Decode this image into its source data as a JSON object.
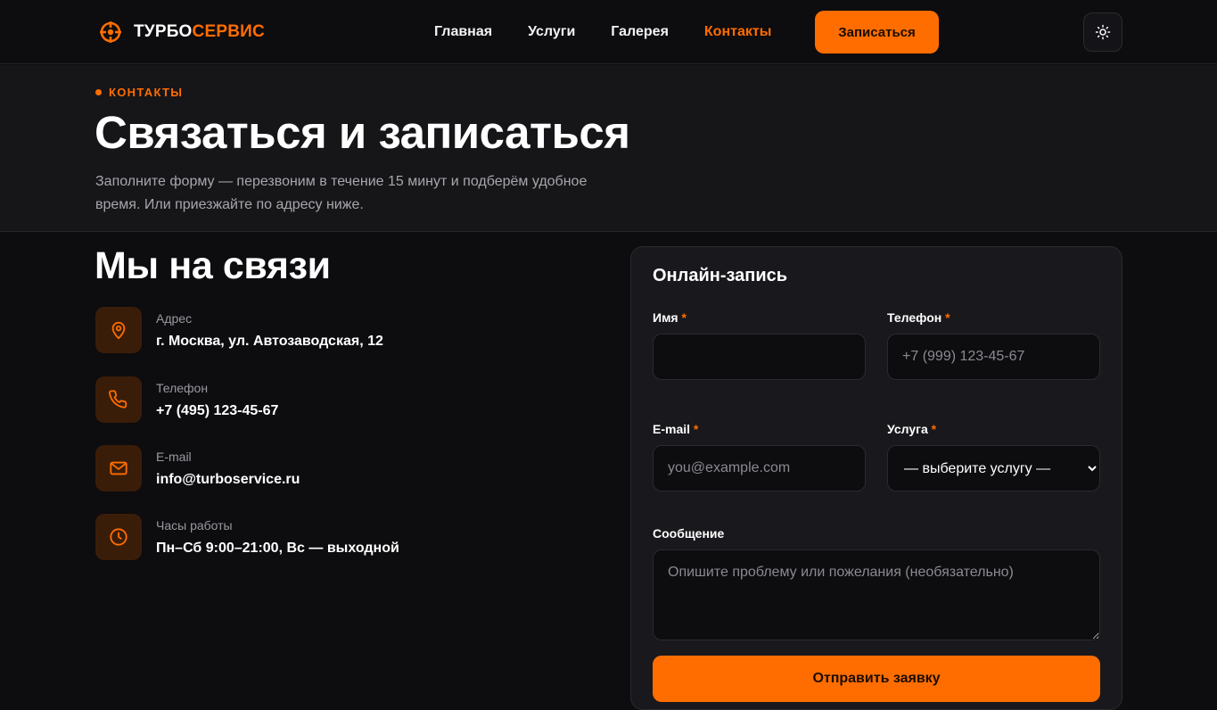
{
  "brand": {
    "name_part1": "ТУРБО",
    "name_part2": "СЕРВИС",
    "accent": "#ff6d00"
  },
  "nav": {
    "items": [
      {
        "label": "Главная",
        "active": false
      },
      {
        "label": "Услуги",
        "active": false
      },
      {
        "label": "Галерея",
        "active": false
      },
      {
        "label": "Контакты",
        "active": true
      }
    ],
    "cta_label": "Записаться",
    "theme_toggle_icon": "sun-icon"
  },
  "hero": {
    "eyebrow": "КОНТАКТЫ",
    "title": "Связаться и записаться",
    "subtitle": "Заполните форму — перезвоним в течение 15 минут и подберём удобное время. Или приезжайте по адресу ниже."
  },
  "contacts": {
    "title": "Мы на связи",
    "items": [
      {
        "icon": "map-pin-icon",
        "label": "Адрес",
        "value": "г. Москва, ул. Автозаводская, 12"
      },
      {
        "icon": "phone-icon",
        "label": "Телефон",
        "value": "+7 (495) 123-45-67"
      },
      {
        "icon": "mail-icon",
        "label": "E-mail",
        "value": "info@turboservice.ru"
      },
      {
        "icon": "clock-icon",
        "label": "Часы работы",
        "value": "Пн–Сб 9:00–21:00, Вс — выходной"
      }
    ]
  },
  "form": {
    "title": "Онлайн-запись",
    "required_mark": "*",
    "name": {
      "label": "Имя",
      "value": "",
      "placeholder": ""
    },
    "phone": {
      "label": "Телефон",
      "value": "",
      "placeholder": "+7 (999) 123-45-67"
    },
    "email": {
      "label": "E-mail",
      "value": "",
      "placeholder": "you@example.com"
    },
    "service": {
      "label": "Услуга",
      "selected": "— выберите услугу —"
    },
    "message": {
      "label": "Сообщение",
      "value": "",
      "placeholder": "Опишите проблему или пожелания (необязательно)"
    },
    "submit_label": "Отправить заявку"
  }
}
